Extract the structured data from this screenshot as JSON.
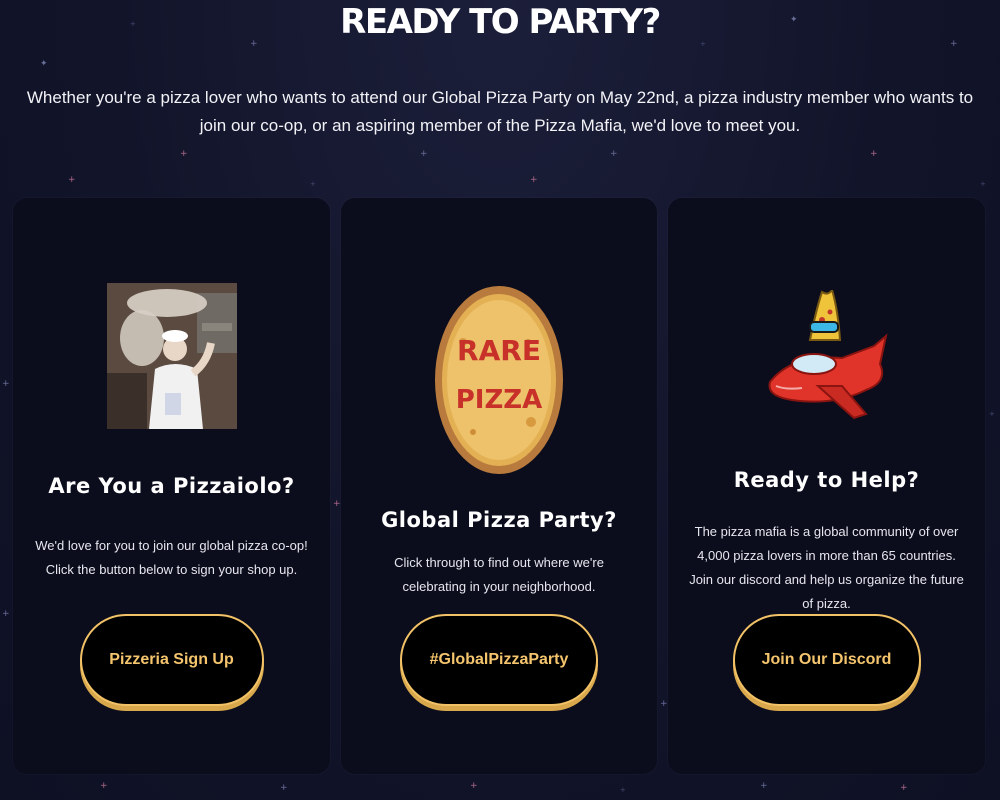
{
  "header": {
    "title": "READY TO PARTY?",
    "intro": "Whether you're a pizza lover who wants to attend our Global Pizza Party on May 22nd, a pizza industry member who wants to join our co-op, or an aspiring member of the Pizza Mafia, we'd love to meet you."
  },
  "cards": [
    {
      "title": "Are You a Pizzaiolo?",
      "text": "We'd love for you to join our global pizza co-op! Click the button below to sign your shop up.",
      "button": "Pizzeria Sign Up",
      "image": "pizzaiolo-tossing-dough-photo"
    },
    {
      "title": "Global Pizza Party?",
      "text": "Click through to find out where we're celebrating in your neighborhood.",
      "button": "#GlobalPizzaParty",
      "image": "rare-pizza-image",
      "image_text": [
        "RARE",
        "PIZZA"
      ]
    },
    {
      "title": "Ready to Help?",
      "text": "The pizza mafia is a global community of over 4,000 pizza lovers in more than 65 countries. Join our discord and help us organize the future of pizza.",
      "button": "Join Our Discord",
      "image": "pizza-slice-on-red-plane-illustration"
    }
  ],
  "colors": {
    "background": "#12142a",
    "card_background": "#0b0d1d",
    "button_accent": "#f2c267",
    "button_text": "#f5c56d"
  }
}
